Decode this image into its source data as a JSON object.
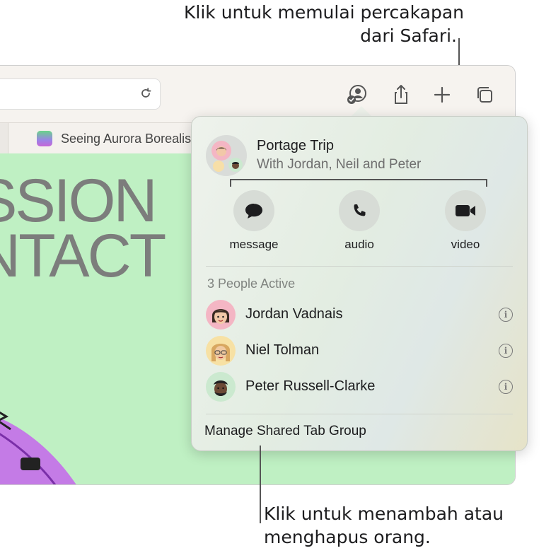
{
  "callouts": {
    "top_line1": "Klik untuk memulai percakapan",
    "top_line2": "dari Safari.",
    "bottom_line1": "Klik untuk menambah atau",
    "bottom_line2": "menghapus orang."
  },
  "browser": {
    "tab_title": "Seeing Aurora Borealis",
    "page_text_line1": "SSION",
    "page_text_line2": "NTACT"
  },
  "popover": {
    "group_title": "Portage Trip",
    "group_subtitle": "With Jordan, Neil and Peter",
    "actions": [
      {
        "label": "message",
        "icon": "message-bubble-icon"
      },
      {
        "label": "audio",
        "icon": "phone-icon"
      },
      {
        "label": "video",
        "icon": "video-camera-icon"
      }
    ],
    "people_header": "3 People Active",
    "people": [
      {
        "name": "Jordan Vadnais"
      },
      {
        "name": "Niel Tolman"
      },
      {
        "name": "Peter Russell-Clarke"
      }
    ],
    "manage_label": "Manage Shared Tab Group"
  },
  "colors": {
    "page_background": "#bff0c3",
    "accent_green": "#1f9b3a"
  }
}
